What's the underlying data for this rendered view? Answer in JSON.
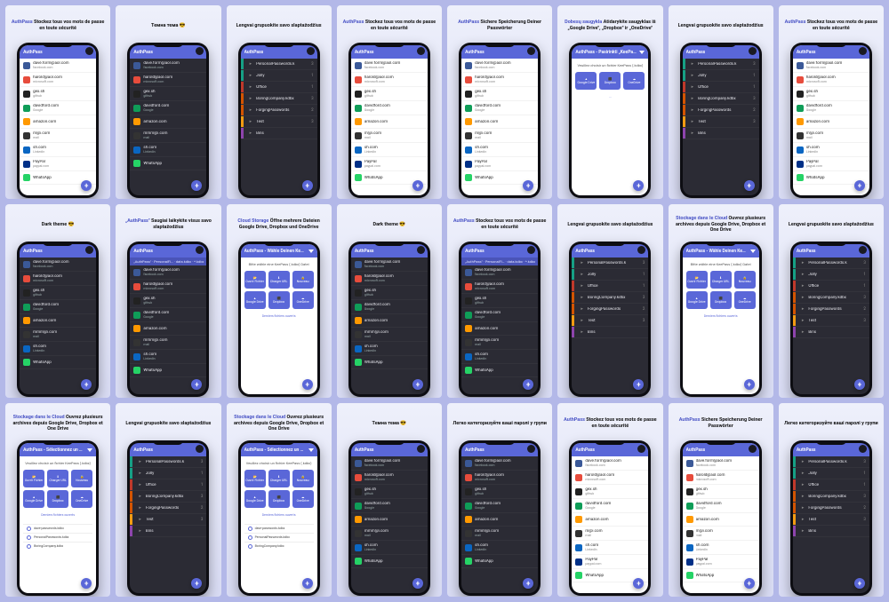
{
  "app_name": "AuthPass",
  "captions": {
    "fr_secure": {
      "brand": "AuthPass",
      "text": " Stockez tous vos mots de passe en toute sécurité"
    },
    "uk_dark": {
      "text": "Темна тема 😎"
    },
    "lt_group": {
      "text": "Lengvai grupuokite savo slaptažodžius"
    },
    "de_secure": {
      "brand": "AuthPass",
      "text": " Sichere Speicherung Deiner Passwörter"
    },
    "lt_cloud": {
      "brand": "Dobesų saugykla",
      "text": " Atidarykite saugyklas iš „Google Drive\", „Dropbox\" ir „OneDrive\""
    },
    "en_dark": {
      "text": "Dark theme 😎"
    },
    "lt_secure": {
      "brand": "„AuthPass\"",
      "text": " Saugiai laikykite visus savo slaptažodžius"
    },
    "de_cloud": {
      "brand": "Cloud Storage",
      "text": " Öffne mehrere Dateien Google Drive, Dropbox und OneDrive"
    },
    "fr_cloud": {
      "brand": "Stockage dans le Cloud",
      "text": " Ouvrez plusieurs archives depuis Google Drive, Dropbox et One Drive"
    },
    "uk_group": {
      "text": "Легко категоризуйте ваші паролі у групи"
    }
  },
  "appbar_titles": {
    "plain": "AuthPass",
    "select_de": "AuthPass - Wähle Deinen KeePass…",
    "select_fr": "AuthPass - Sélectionnez un fichier KeePass…",
    "select_lt": "AuthPass - Pasirinkti „KeePass\" failą"
  },
  "subbar_text": "„AuthPass\" · PersonalFi… · data.kdbx · *.kdbx",
  "entries_light": [
    {
      "ic": "c-fb",
      "name": "dave.form@aol.com",
      "sub": "facebook.com"
    },
    {
      "ic": "c-ms",
      "name": "harold@aol.com",
      "sub": "microsoft.com"
    },
    {
      "ic": "c-gh",
      "name": "gex.sh",
      "sub": "github"
    },
    {
      "ic": "c-gd",
      "name": "davidford.com",
      "sub": "Google"
    },
    {
      "ic": "c-am",
      "name": "amazon.com",
      "sub": ""
    },
    {
      "ic": "c-dk",
      "name": "m@i.com",
      "sub": "mail"
    },
    {
      "ic": "c-li",
      "name": "sh.com",
      "sub": "LinkedIn"
    },
    {
      "ic": "c-pp",
      "name": "PayPal",
      "sub": "paypal.com"
    },
    {
      "ic": "c-wa",
      "name": "WhatsApp",
      "sub": ""
    }
  ],
  "entries_dark": [
    {
      "ic": "c-fb",
      "name": "dave.form@aol.com",
      "sub": "facebook.com"
    },
    {
      "ic": "c-ms",
      "name": "harold@aol.com",
      "sub": "microsoft.com"
    },
    {
      "ic": "c-gh",
      "name": "gex.sh",
      "sub": "github"
    },
    {
      "ic": "c-gd",
      "name": "davidford.com",
      "sub": "Google"
    },
    {
      "ic": "c-am",
      "name": "amazon.com",
      "sub": ""
    },
    {
      "ic": "c-dk",
      "name": "mmm@i.com",
      "sub": "mail"
    },
    {
      "ic": "c-li",
      "name": "sh.com",
      "sub": "LinkedIn"
    },
    {
      "ic": "c-wa",
      "name": "WhatsApp",
      "sub": ""
    }
  ],
  "groups": [
    {
      "color": "#16a085",
      "label": "PersonalPasswords.k",
      "count": "3"
    },
    {
      "color": "#16a085",
      "label": "Jolly",
      "count": "1"
    },
    {
      "color": "#c0392b",
      "label": "Office",
      "count": "1"
    },
    {
      "color": "#d35400",
      "label": "BoringCompany.kdbx",
      "count": "3"
    },
    {
      "color": "#d35400",
      "label": "ForgingPasswords",
      "count": "2"
    },
    {
      "color": "#f39c12",
      "label": "Test",
      "count": "3"
    },
    {
      "color": "#8e44ad",
      "label": "Bins",
      "count": ""
    }
  ],
  "cloud": {
    "head_fr": "Veuillez choisir un fichier KeePass (.kdbx)",
    "head_de": "Bitte wähle eine KeePass (.kdbx) Datei",
    "tiles": [
      {
        "icon": "📂",
        "label": "Ouvrir Fichier"
      },
      {
        "icon": "⬇",
        "label": "Charger URL"
      },
      {
        "icon": "🔒",
        "label": "Nouveau"
      },
      {
        "icon": "▲",
        "label": "Google Drive"
      },
      {
        "icon": "⬛",
        "label": "Dropbox"
      },
      {
        "icon": "☁",
        "label": "OneDrive"
      }
    ],
    "tiles_small": [
      {
        "icon": "▲",
        "label": "Google Drive"
      },
      {
        "icon": "⬛",
        "label": "Dropbox"
      },
      {
        "icon": "☁",
        "label": "OneDrive"
      }
    ],
    "foot": "Derniers fichiers ouverts",
    "files": [
      "dave-passwords.kdbx",
      "PersonalPasswords.kdbx",
      "BoringCompany.kdbx"
    ]
  },
  "fab_label": "+",
  "layout": [
    [
      "fr_secure_light",
      "uk_dark_dark",
      "lt_group_groups",
      "fr_secure_light",
      "de_secure_light",
      "lt_cloud_cloudsm",
      "lt_group_groups",
      "fr_secure_light"
    ],
    [
      "en_dark_dark",
      "lt_secure_darksub",
      "de_cloud_cloud",
      "en_dark_dark",
      "fr_secure_darksub",
      "lt_group_groups",
      "fr_cloud_cloud",
      "fr_secure_darksub",
      "lt_group_groups"
    ],
    [
      "fr_cloud_cloudfiles",
      "lt_group_groupsdark",
      "fr_cloud_cloudfiles",
      "uk_dark_dark",
      "uk_group_darklist",
      "fr_secure_light",
      "de_secure_light",
      "uk_group_groups"
    ]
  ]
}
